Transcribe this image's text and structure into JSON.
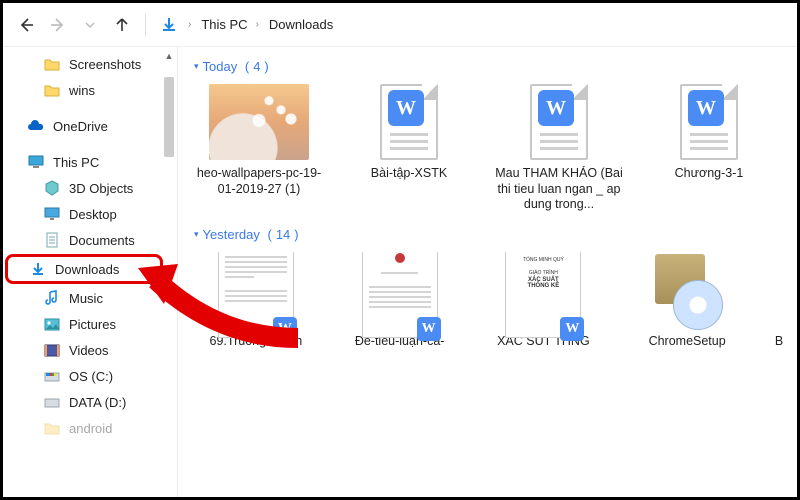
{
  "toolbar": {
    "path_root": "This PC",
    "path_current": "Downloads"
  },
  "sidebar": {
    "items": [
      {
        "label": "Screenshots",
        "icon": "folder"
      },
      {
        "label": "wins",
        "icon": "folder"
      },
      {
        "label": "OneDrive",
        "icon": "onedrive"
      },
      {
        "label": "This PC",
        "icon": "thispc"
      },
      {
        "label": "3D Objects",
        "icon": "3d"
      },
      {
        "label": "Desktop",
        "icon": "desktop"
      },
      {
        "label": "Documents",
        "icon": "documents"
      },
      {
        "label": "Downloads",
        "icon": "downloads"
      },
      {
        "label": "Music",
        "icon": "music"
      },
      {
        "label": "Pictures",
        "icon": "pictures"
      },
      {
        "label": "Videos",
        "icon": "videos"
      },
      {
        "label": "OS (C:)",
        "icon": "disk"
      },
      {
        "label": "DATA (D:)",
        "icon": "disk"
      },
      {
        "label": "android",
        "icon": "folder"
      }
    ]
  },
  "groups": {
    "today": {
      "label": "Today",
      "count": 4
    },
    "yesterday": {
      "label": "Yesterday",
      "count": 14
    }
  },
  "today_items": [
    {
      "label": "heo-wallpapers-pc-19-01-2019-27 (1)"
    },
    {
      "label": "Bài-tập-XSTK"
    },
    {
      "label": "Mau THAM KHẢO (Bai thi tieu luan ngan _ ap dung trong..."
    },
    {
      "label": "Chương-3-1"
    }
  ],
  "yesterday_items": [
    {
      "label": "69.TruongKhanh"
    },
    {
      "label": "Đề-tiểu-luận-cá-"
    },
    {
      "label": "XAC SUT THNG",
      "preview_top": "GIÁO TRÌNH",
      "preview_mid": "XÁC SUẤT",
      "preview_bot": "THỐNG KÊ"
    },
    {
      "label": "ChromeSetup"
    },
    {
      "label": "B"
    }
  ],
  "yesterday_preview2_top": "TỔNG MINH QUÝ"
}
